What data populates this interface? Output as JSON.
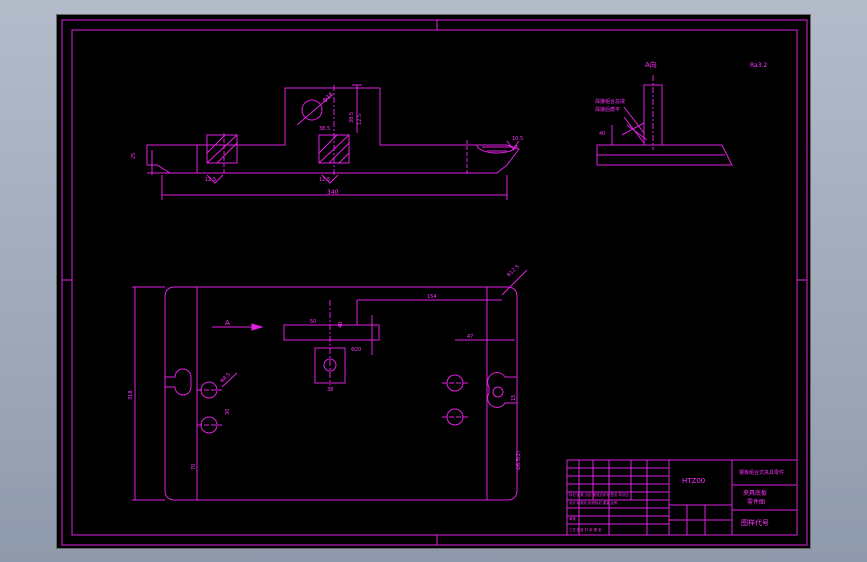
{
  "drawing": {
    "colors": {
      "line": "#e020e0",
      "background": "#000000",
      "outside": "#9aa4b6"
    },
    "front_view": {
      "dims": [
        "Φ16",
        "10.5",
        "38.5",
        "38.5",
        "25",
        "12.5",
        "12.5",
        "340",
        "12.5"
      ]
    },
    "side_view": {
      "label": "A向",
      "notes": [
        "焊接组合总成",
        "焊接后磨平"
      ],
      "dim": "40"
    },
    "surface_note": "Ra3.2",
    "top_view": {
      "arrow_label": "A",
      "dims": [
        "R12.5",
        "154",
        "50",
        "40",
        "Φ20",
        "38",
        "47",
        "318",
        "Φ8.5",
        "30",
        "15",
        "70",
        "Φ8.5(2)"
      ]
    },
    "title_block": {
      "title_cn": "钢板组合式夹具零件",
      "part_no": "HTZ00",
      "name_lines": [
        "夹具底板",
        "零件图"
      ],
      "drawing_code": "图样代号",
      "rows": [
        "标记  处数  分区  更改文件号  签名  年月日",
        "设计    标准化    阶段标记  重量  比例",
        "审核",
        "工艺    批准    共 张  第 张"
      ]
    }
  }
}
